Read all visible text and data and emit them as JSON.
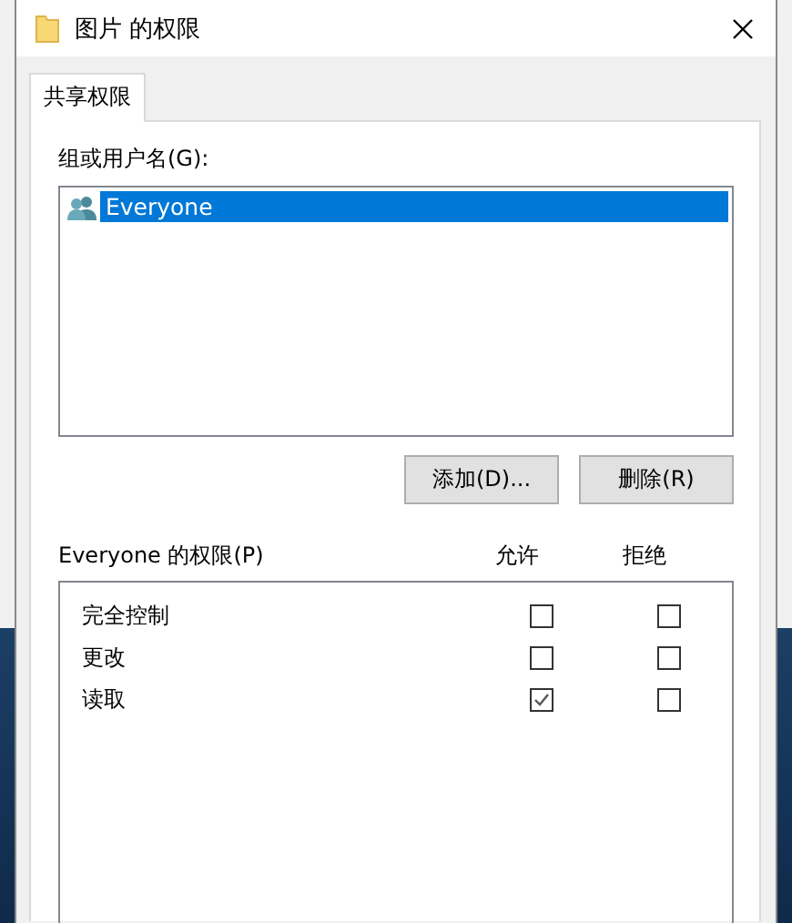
{
  "window": {
    "title": "图片 的权限"
  },
  "tabs": [
    {
      "label": "共享权限",
      "selected": true
    }
  ],
  "groups": {
    "label": "组或用户名(G):",
    "items": [
      {
        "name": "Everyone",
        "selected": true
      }
    ]
  },
  "buttons": [
    {
      "label": "添加(D)..."
    },
    {
      "label": "删除(R)"
    }
  ],
  "permissions": {
    "label": "Everyone 的权限(P)",
    "columns": [
      "允许",
      "拒绝"
    ],
    "rows": [
      {
        "name": "完全控制",
        "allow": false,
        "deny": false
      },
      {
        "name": "更改",
        "allow": false,
        "deny": false
      },
      {
        "name": "读取",
        "allow": true,
        "deny": false
      }
    ]
  }
}
